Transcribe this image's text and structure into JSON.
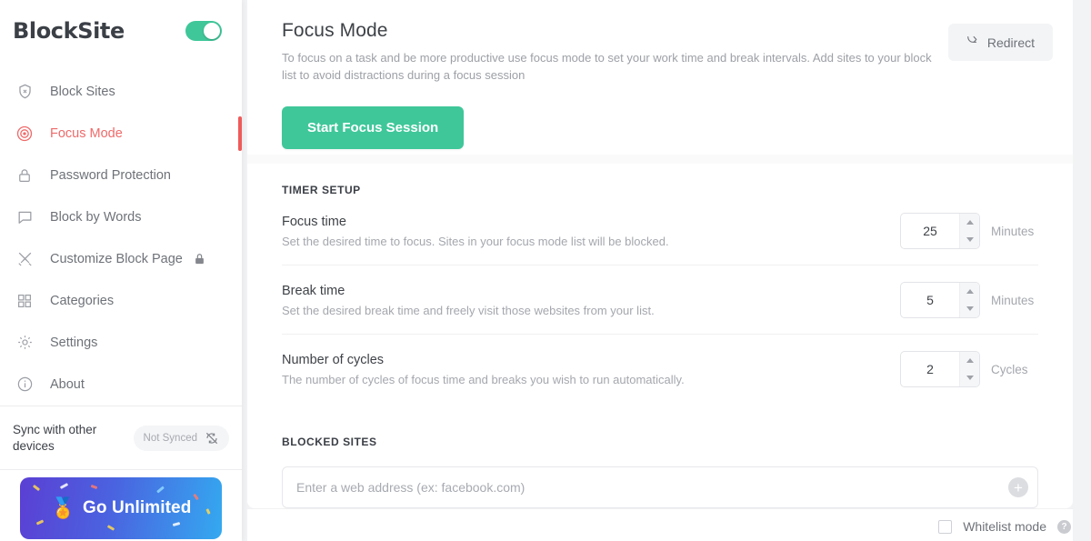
{
  "brand": {
    "name": "BlockSite",
    "master_toggle_state": "on",
    "accent_green": "#3fc79a",
    "accent_red": "#ef5a5a"
  },
  "sidebar": {
    "items": [
      {
        "label": "Block Sites",
        "icon": "shield-x-icon",
        "active": false,
        "locked": false
      },
      {
        "label": "Focus Mode",
        "icon": "target-icon",
        "active": true,
        "locked": false
      },
      {
        "label": "Password Protection",
        "icon": "padlock-icon",
        "active": false,
        "locked": false
      },
      {
        "label": "Block by Words",
        "icon": "speech-bubble-icon",
        "active": false,
        "locked": false
      },
      {
        "label": "Customize Block Page",
        "icon": "tools-icon",
        "active": false,
        "locked": true
      },
      {
        "label": "Categories",
        "icon": "grid-icon",
        "active": false,
        "locked": false
      },
      {
        "label": "Settings",
        "icon": "gear-icon",
        "active": false,
        "locked": false
      },
      {
        "label": "About",
        "icon": "info-circle-icon",
        "active": false,
        "locked": false
      }
    ],
    "sync": {
      "label": "Sync with other devices",
      "status": "Not Synced",
      "icon": "sync-off-icon"
    },
    "promo": {
      "label": "Go Unlimited",
      "icon": "medal-emoji"
    }
  },
  "header": {
    "title": "Focus Mode",
    "subtitle": "To focus on a task and be more productive use focus mode to set your work time and break intervals. Add sites to your block list to avoid distractions during a focus session",
    "redirect_label": "Redirect",
    "redirect_icon": "redirect-arrow-icon",
    "start_button": "Start Focus Session"
  },
  "timer_setup": {
    "title": "TIMER SETUP",
    "rows": [
      {
        "title": "Focus time",
        "desc": "Set the desired time to focus. Sites in your focus mode list will be blocked.",
        "value": "25",
        "unit": "Minutes"
      },
      {
        "title": "Break time",
        "desc": "Set the desired break time and freely visit those websites from your list.",
        "value": "5",
        "unit": "Minutes"
      },
      {
        "title": "Number of cycles",
        "desc": "The number of cycles of focus time and breaks you wish to run automatically.",
        "value": "2",
        "unit": "Cycles"
      }
    ]
  },
  "blocked_sites": {
    "title": "BLOCKED SITES",
    "input_placeholder": "Enter a web address (ex: facebook.com)",
    "input_value": "",
    "add_icon": "plus-circle-icon",
    "whitelist_label": "Whitelist mode",
    "whitelist_checked": false,
    "help_icon": "question-mark-icon"
  }
}
